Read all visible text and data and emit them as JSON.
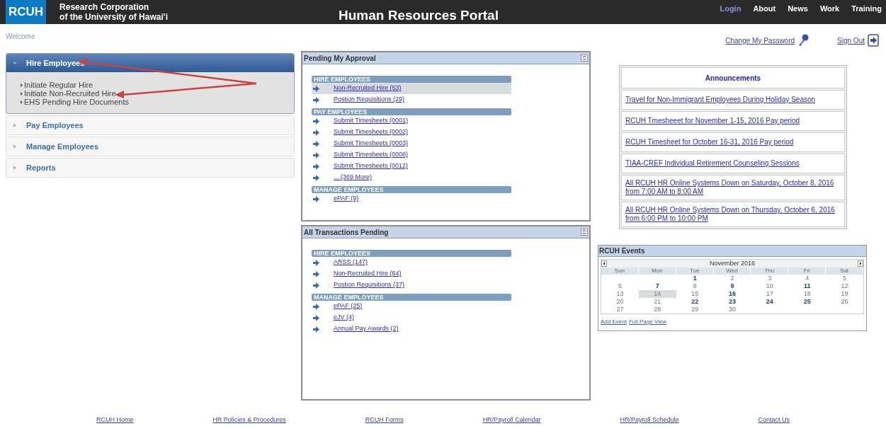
{
  "header": {
    "logo": "RCUH",
    "org_line_1": "Research Corporation",
    "org_line_2": "of the University of Hawai'i",
    "title": "Human Resources Portal",
    "nav": [
      {
        "label": "Login",
        "selected": true
      },
      {
        "label": "About",
        "selected": false
      },
      {
        "label": "News",
        "selected": false
      },
      {
        "label": "Work",
        "selected": false
      },
      {
        "label": "Training",
        "selected": false
      }
    ]
  },
  "welcome": "Welcome",
  "account_links": [
    {
      "kind": "password",
      "label": "Change My Password"
    },
    {
      "kind": "signout",
      "label": "Sign Out"
    }
  ],
  "sidebar": {
    "sections": [
      {
        "label": "Hire Employees",
        "expanded": true,
        "children": [
          {
            "label": "Initiate Regular Hire"
          },
          {
            "label": "Initiate Non-Recruited Hire"
          },
          {
            "label": "EHS Pending Hire Documents"
          }
        ]
      },
      {
        "label": "Pay Employees",
        "expanded": false
      },
      {
        "label": "Manage Employees",
        "expanded": false
      },
      {
        "label": "Reports",
        "expanded": false
      }
    ]
  },
  "panels": [
    {
      "title": "Pending My Approval",
      "groups": [
        {
          "title": "HIRE EMPLOYEES",
          "items": [
            {
              "label": "Non-Recruited Hire (53)",
              "selected": true
            },
            {
              "label": "Postion Requisitions (29)",
              "selected": false
            }
          ]
        },
        {
          "title": "PAY EMPLOYEES",
          "items": [
            {
              "label": "Submit Timesheets (0001)",
              "selected": false
            },
            {
              "label": "Submit Timesheets (0002)",
              "selected": false
            },
            {
              "label": "Submit Timesheets (0003)",
              "selected": false
            },
            {
              "label": "Submit Timesheets (0008)",
              "selected": false
            },
            {
              "label": "Submit Timesheets (0012)",
              "selected": false
            },
            {
              "label": "... (369 More)",
              "selected": false
            }
          ]
        },
        {
          "title": "MANAGE EMPLOYEES",
          "items": [
            {
              "label": "ePAF (9)",
              "selected": false
            }
          ]
        }
      ]
    },
    {
      "title": "All Transactions Pending",
      "groups": [
        {
          "title": "HIRE EMPLOYEES",
          "items": [
            {
              "label": "ARSS (147)",
              "selected": false
            },
            {
              "label": "Non-Recruited Hire (64)",
              "selected": false
            },
            {
              "label": "Postion Requisitions (37)",
              "selected": false
            }
          ]
        },
        {
          "title": "MANAGE EMPLOYEES",
          "items": [
            {
              "label": "ePAF (25)",
              "selected": false
            },
            {
              "label": "eJV (4)",
              "selected": false
            },
            {
              "label": "Annual Pay Awards (2)",
              "selected": false
            }
          ]
        }
      ]
    }
  ],
  "announcements": {
    "title": "Announcements",
    "items": [
      "Travel for Non-Immigrant Employees During Holiday Season",
      "RCUH Tmesheeet for November 1-15, 2016 Pay period",
      "RCUH Timesheet for October 16-31, 2016 Pay period",
      "TIAA-CREF Individual Retirement Counseling Sessions",
      "All RCUH HR Online Systems Down on Saturday, October 8, 2016 from 7:00 AM to 8:00 AM",
      "All RCUH HR Online Systems Down on Thursday, October 6, 2016 from 6:00 PM to 10:00 PM"
    ]
  },
  "events": {
    "title": "RCUH Events",
    "month": "November 2016",
    "weekdays": [
      "Sun",
      "Mon",
      "Tue",
      "Wed",
      "Thu",
      "Fri",
      "Sat"
    ],
    "weeks": [
      [
        {
          "day": "1",
          "event": true,
          "selected": false
        },
        {
          "day": "2",
          "event": false,
          "selected": false
        },
        {
          "day": "3",
          "event": false,
          "selected": false
        },
        {
          "day": "4",
          "event": false,
          "selected": false
        },
        {
          "day": "5",
          "event": false,
          "selected": false
        }
      ],
      [
        {
          "day": "6",
          "event": false,
          "selected": false
        },
        {
          "day": "7",
          "event": true,
          "selected": false
        },
        {
          "day": "8",
          "event": false,
          "selected": false
        },
        {
          "day": "9",
          "event": true,
          "selected": false
        },
        {
          "day": "10",
          "event": false,
          "selected": false
        },
        {
          "day": "11",
          "event": true,
          "selected": false
        },
        {
          "day": "12",
          "event": false,
          "selected": false
        }
      ],
      [
        {
          "day": "13",
          "event": false,
          "selected": false
        },
        {
          "day": "14",
          "event": false,
          "selected": true
        },
        {
          "day": "15",
          "event": false,
          "selected": false
        },
        {
          "day": "16",
          "event": true,
          "selected": false
        },
        {
          "day": "17",
          "event": false,
          "selected": false
        },
        {
          "day": "18",
          "event": false,
          "selected": false
        },
        {
          "day": "19",
          "event": false,
          "selected": false
        }
      ],
      [
        {
          "day": "20",
          "event": false,
          "selected": false
        },
        {
          "day": "21",
          "event": false,
          "selected": false
        },
        {
          "day": "22",
          "event": true,
          "selected": false
        },
        {
          "day": "23",
          "event": true,
          "selected": false
        },
        {
          "day": "24",
          "event": true,
          "selected": false
        },
        {
          "day": "25",
          "event": true,
          "selected": false
        },
        {
          "day": "26",
          "event": false,
          "selected": false
        }
      ],
      [
        {
          "day": "27",
          "event": false,
          "selected": false
        },
        {
          "day": "28",
          "event": false,
          "selected": false
        },
        {
          "day": "29",
          "event": false,
          "selected": false
        },
        {
          "day": "30",
          "event": false,
          "selected": false
        }
      ]
    ],
    "links": [
      "Add Event",
      "Full Page View"
    ]
  },
  "footer": [
    "RCUH Home",
    "HR Policies & Procedures",
    "RCUH Forms",
    "HR/Payroll Calendar",
    "HR/Payroll Schedule",
    "Contact Us"
  ]
}
